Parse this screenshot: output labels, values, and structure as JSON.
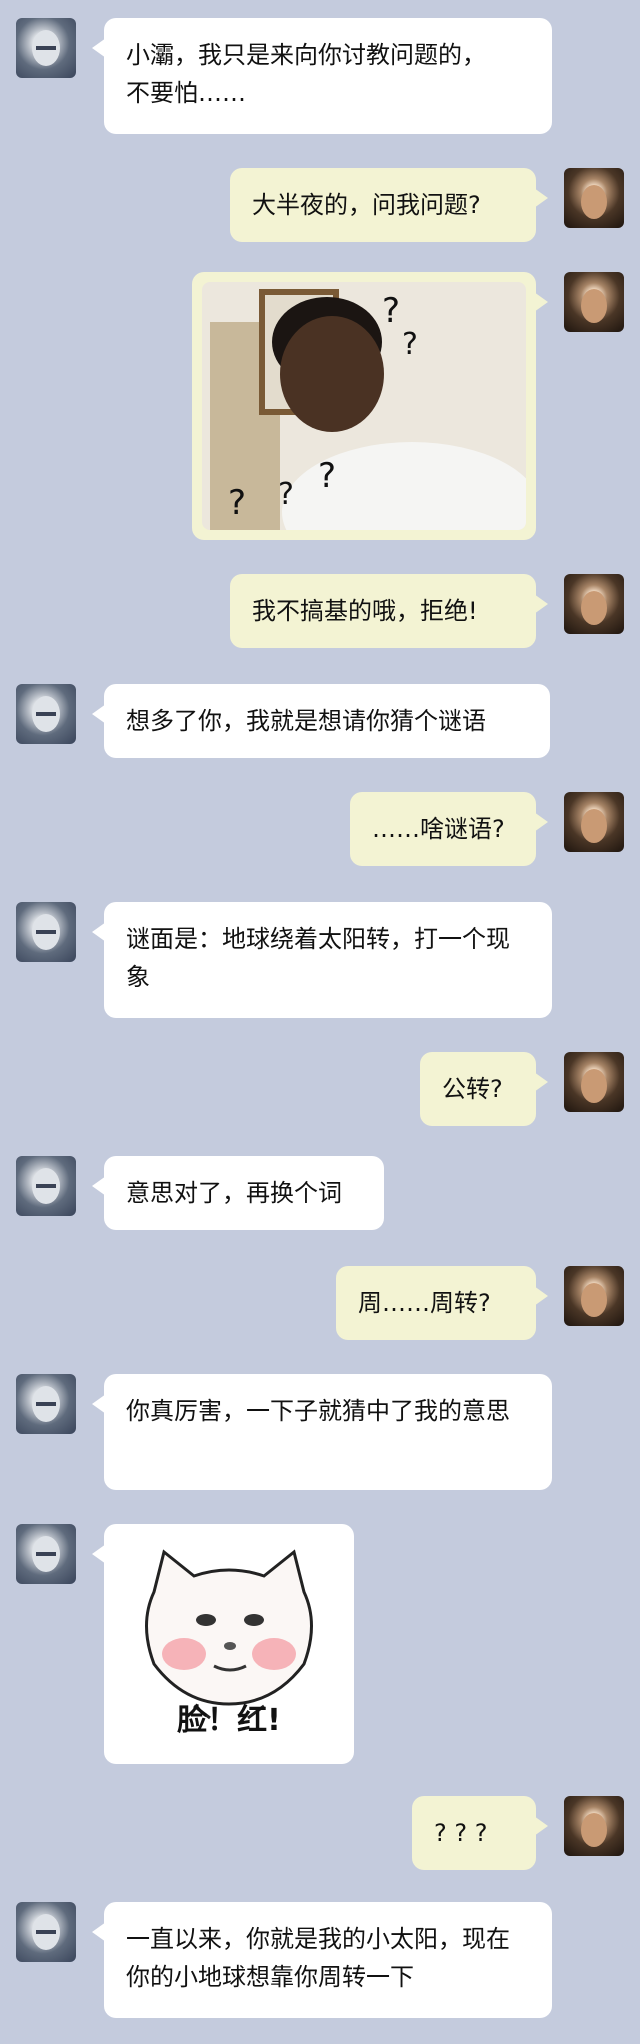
{
  "chat": {
    "messages": [
      {
        "side": "left",
        "text": "小灞，我只是来向你讨教问题的，\n不要怕……"
      },
      {
        "side": "right",
        "text": "大半夜的，问我问题?"
      },
      {
        "side": "right",
        "image": "confused-man-question-marks-sticker"
      },
      {
        "side": "right",
        "text": "我不搞基的哦，拒绝!"
      },
      {
        "side": "left",
        "text": "想多了你，我就是想请你猜个谜语"
      },
      {
        "side": "right",
        "text": "……啥谜语?"
      },
      {
        "side": "left",
        "text": "谜面是：地球绕着太阳转，打一个现象"
      },
      {
        "side": "right",
        "text": "公转?"
      },
      {
        "side": "left",
        "text": "意思对了，再换个词"
      },
      {
        "side": "right",
        "text": "周……周转?"
      },
      {
        "side": "left",
        "text": "你真厉害，一下子就猜中了我的意思"
      },
      {
        "side": "left",
        "image": "blushing-cat-face-sticker",
        "caption": "脸！红!"
      },
      {
        "side": "right",
        "text": "? ? ?"
      },
      {
        "side": "left",
        "text": "一直以来，你就是我的小太阳，现在你的小地球想靠你周转一下"
      }
    ]
  },
  "colors": {
    "background": "#c4cbdd",
    "left_bubble": "#ffffff",
    "right_bubble": "#f3f3d3"
  },
  "icons": {
    "left_avatar": "armored-figure-avatar",
    "right_avatar": "bald-man-avatar"
  }
}
